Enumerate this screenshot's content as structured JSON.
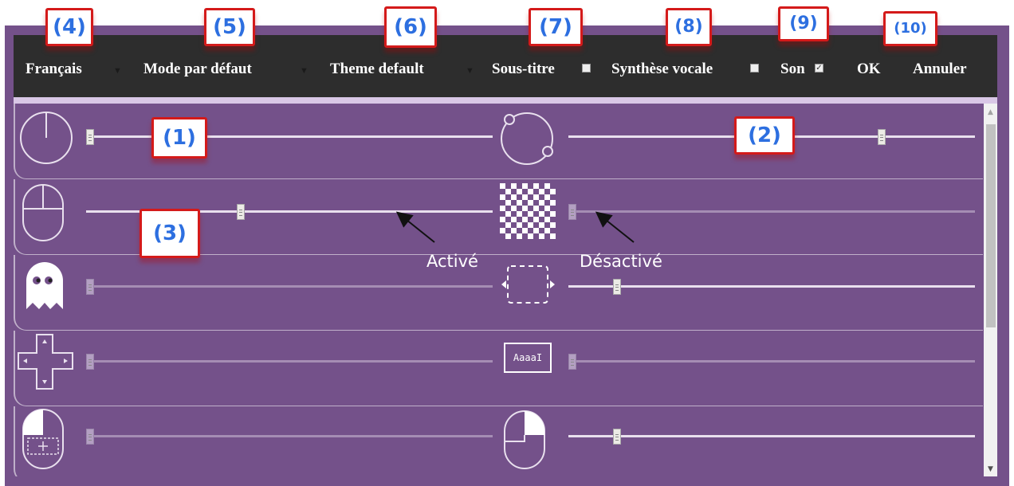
{
  "toolbar": {
    "language": "Français",
    "mode": "Mode par défaut",
    "theme": "Theme default",
    "subtitles": {
      "label": "Sous-titre",
      "checked": false
    },
    "tts": {
      "label": "Synthèse vocale",
      "checked": false
    },
    "sound": {
      "label": "Son",
      "checked": true
    },
    "ok": "OK",
    "cancel": "Annuler"
  },
  "callouts": [
    "(1)",
    "(2)",
    "(3)",
    "(4)",
    "(5)",
    "(6)",
    "(7)",
    "(8)",
    "(9)",
    "(10)"
  ],
  "annotations": {
    "enabled": "Activé",
    "disabled": "Désactivé"
  },
  "sliders": [
    {
      "icon": "clock-icon",
      "value": 0.01,
      "enabled": true
    },
    {
      "icon": "circle-orbit-icon",
      "value": 0.77,
      "enabled": true
    },
    {
      "icon": "mouse-icon",
      "value": 0.38,
      "enabled": true
    },
    {
      "icon": "checkerboard-icon",
      "value": 0.01,
      "enabled": false
    },
    {
      "icon": "ghost-icon",
      "value": 0.01,
      "enabled": false
    },
    {
      "icon": "dashed-frame-icon",
      "value": 0.12,
      "enabled": true
    },
    {
      "icon": "dpad-icon",
      "value": 0.01,
      "enabled": false
    },
    {
      "icon": "text-cursor-icon",
      "value": 0.01,
      "enabled": false,
      "icon_text": "Aaaa"
    },
    {
      "icon": "mouse-left-click-icon",
      "value": 0.01,
      "enabled": false
    },
    {
      "icon": "mouse-right-click-icon",
      "value": 0.12,
      "enabled": true
    }
  ],
  "colors": {
    "frame": "#74518a",
    "toolbar": "#2d2d2d",
    "callout_border": "#d41a1a",
    "callout_text": "#2d6fe0"
  }
}
